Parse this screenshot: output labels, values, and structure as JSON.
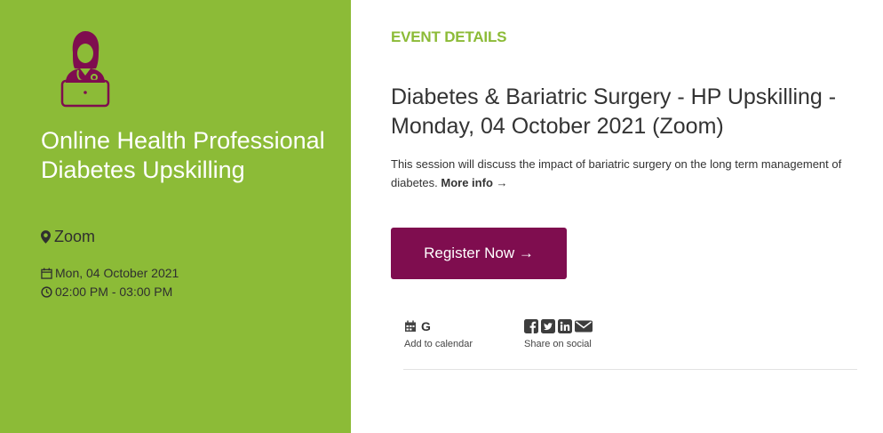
{
  "left_panel": {
    "event_name": "Online Health Professional Diabetes Upskilling",
    "location": "Zoom",
    "date": "Mon, 04 October 2021",
    "time": "02:00 PM - 03:00 PM"
  },
  "details": {
    "heading": "EVENT DETAILS",
    "title": "Diabetes & Bariatric Surgery - HP Upskilling - Monday, 04 October 2021 (Zoom)",
    "description": "This session will discuss the impact of bariatric surgery on the long term management of diabetes.",
    "more_info": "More info →",
    "register_label": "Register Now →",
    "calendar_google": "G",
    "add_to_calendar": "Add to calendar",
    "share_on_social": "Share on social"
  },
  "colors": {
    "panel_green": "#8cbb37",
    "register_purple": "#7f0d4f",
    "heading_green": "#8cbb37"
  },
  "icons": [
    "doctor-laptop-icon",
    "map-marker-icon",
    "calendar-icon",
    "clock-icon",
    "facebook-icon",
    "twitter-icon",
    "linkedin-icon",
    "email-icon"
  ]
}
